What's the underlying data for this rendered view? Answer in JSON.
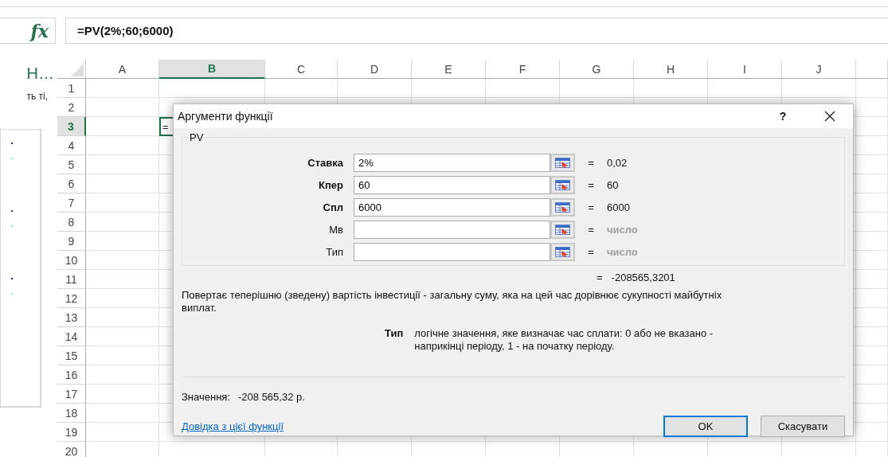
{
  "formula_bar": {
    "function_label": "fx",
    "formula": "=PV(2%;60;6000)"
  },
  "side_panel": {
    "heading": "Н…",
    "text": "ть ті,"
  },
  "sheet": {
    "columns": [
      {
        "label": "A",
        "selected": false
      },
      {
        "label": "B",
        "selected": true
      },
      {
        "label": "C",
        "selected": false
      },
      {
        "label": "D",
        "selected": false
      },
      {
        "label": "E",
        "selected": false
      },
      {
        "label": "F",
        "selected": false
      },
      {
        "label": "G",
        "selected": false
      },
      {
        "label": "H",
        "selected": false
      },
      {
        "label": "I",
        "selected": false
      },
      {
        "label": "J",
        "selected": false
      }
    ],
    "rows": [
      {
        "label": "1",
        "selected": false
      },
      {
        "label": "2",
        "selected": false
      },
      {
        "label": "3",
        "selected": true
      },
      {
        "label": "4",
        "selected": false
      },
      {
        "label": "5",
        "selected": false
      },
      {
        "label": "6",
        "selected": false
      },
      {
        "label": "7",
        "selected": false
      },
      {
        "label": "8",
        "selected": false
      },
      {
        "label": "9",
        "selected": false
      },
      {
        "label": "10",
        "selected": false
      },
      {
        "label": "11",
        "selected": false
      },
      {
        "label": "12",
        "selected": false
      },
      {
        "label": "13",
        "selected": false
      },
      {
        "label": "14",
        "selected": false
      },
      {
        "label": "15",
        "selected": false
      },
      {
        "label": "16",
        "selected": false
      },
      {
        "label": "17",
        "selected": false
      },
      {
        "label": "18",
        "selected": false
      },
      {
        "label": "19",
        "selected": false
      },
      {
        "label": "20",
        "selected": false
      }
    ],
    "active_cell": {
      "text": "="
    }
  },
  "dialog": {
    "title": "Аргументи функції",
    "help": "?",
    "function_name": "PV",
    "arguments": [
      {
        "label": "Ставка",
        "required": true,
        "value": "2%",
        "sign": "=",
        "result": "0,02",
        "result_muted": false
      },
      {
        "label": "Кпер",
        "required": true,
        "value": "60",
        "sign": "=",
        "result": "60",
        "result_muted": false
      },
      {
        "label": "Спл",
        "required": true,
        "value": "6000",
        "sign": "=",
        "result": "6000",
        "result_muted": false
      },
      {
        "label": "Мв",
        "required": false,
        "sign": "=",
        "result": "число",
        "result_muted": true
      },
      {
        "label": "Тип",
        "required": false,
        "sign": "=",
        "result": "число",
        "result_muted": true
      }
    ],
    "result_sign": "=",
    "result": "-208565,3201",
    "description": "Повертає теперішню (зведену) вартість інвестиції - загальну суму, яка на цей час дорівнює сукупності майбутніх виплат.",
    "argument_help": {
      "name": "Тип",
      "text": "логічне значення, яке визначає час сплати: 0 або не вказано - наприкінці періоду, 1 - на початку періоду."
    },
    "value_label": "Значення:",
    "value": "-208 565,32 р.",
    "help_link": "Довідка з цієї функції",
    "buttons": [
      {
        "label": "OK",
        "default": true
      },
      {
        "label": "Скасувати",
        "default": false
      }
    ]
  }
}
